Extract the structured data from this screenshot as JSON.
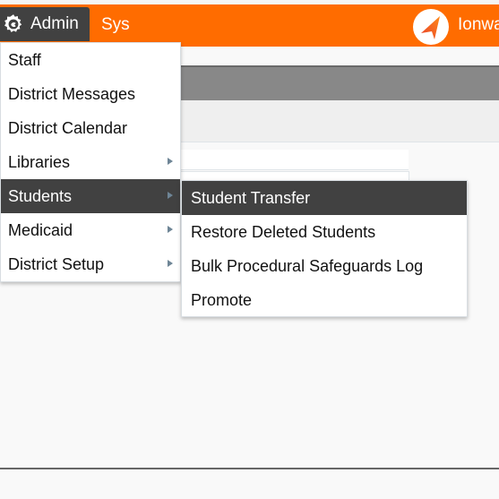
{
  "navbar": {
    "admin_label": "Admin",
    "sys_label": "Sys",
    "brand_label": "Ionwave",
    "accent_color": "#ff6c00",
    "active_color": "#414141"
  },
  "admin_menu": {
    "items": [
      {
        "label": "Staff",
        "has_submenu": false
      },
      {
        "label": "District Messages",
        "has_submenu": false
      },
      {
        "label": "District Calendar",
        "has_submenu": false
      },
      {
        "label": "Libraries",
        "has_submenu": true
      },
      {
        "label": "Students",
        "has_submenu": true,
        "active": true
      },
      {
        "label": "Medicaid",
        "has_submenu": true
      },
      {
        "label": "District Setup",
        "has_submenu": true
      }
    ]
  },
  "students_submenu": {
    "items": [
      {
        "label": "Student Transfer",
        "active": true
      },
      {
        "label": "Restore Deleted Students"
      },
      {
        "label": "Bulk Procedural Safeguards Log"
      },
      {
        "label": "Promote"
      }
    ]
  },
  "icons": {
    "admin": "gear-icon",
    "brand": "paper-plane-logo-icon",
    "submenu": "triangle-right-icon"
  }
}
